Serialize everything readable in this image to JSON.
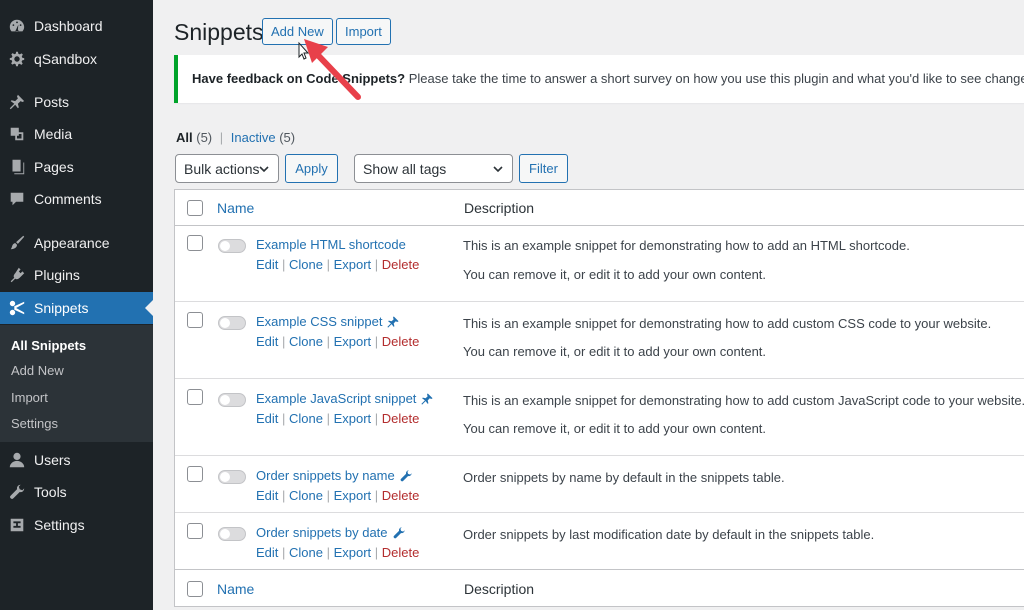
{
  "sidebar": {
    "items": [
      {
        "label": "Dashboard",
        "icon": "dashboard-icon"
      },
      {
        "label": "qSandbox",
        "icon": "gear-icon"
      },
      {
        "label": "Posts",
        "icon": "pin-icon"
      },
      {
        "label": "Media",
        "icon": "media-icon"
      },
      {
        "label": "Pages",
        "icon": "pages-icon"
      },
      {
        "label": "Comments",
        "icon": "comments-icon"
      },
      {
        "label": "Appearance",
        "icon": "brush-icon"
      },
      {
        "label": "Plugins",
        "icon": "plugin-icon"
      },
      {
        "label": "Snippets",
        "icon": "scissors-icon"
      },
      {
        "label": "Users",
        "icon": "user-icon"
      },
      {
        "label": "Tools",
        "icon": "wrench-icon"
      },
      {
        "label": "Settings",
        "icon": "settings-icon"
      }
    ],
    "submenu": [
      "All Snippets",
      "Add New",
      "Import",
      "Settings"
    ]
  },
  "header": {
    "title": "Snippets",
    "add_new": "Add New",
    "import": "Import"
  },
  "notice": {
    "bold": "Have feedback on Code Snippets?",
    "text": " Please take the time to answer a short survey on how you use this plugin and what you'd like to see changed or added"
  },
  "filters": {
    "all_label": "All",
    "all_count": "(5)",
    "separator": "|",
    "inactive_label": "Inactive",
    "inactive_count": "(5)",
    "bulk_actions": "Bulk actions",
    "apply": "Apply",
    "tags": "Show all tags",
    "filter": "Filter"
  },
  "table": {
    "col_name": "Name",
    "col_description": "Description",
    "action_edit": "Edit",
    "action_clone": "Clone",
    "action_export": "Export",
    "action_delete": "Delete",
    "rows": [
      {
        "name": "Example HTML shortcode",
        "icon": "",
        "desc1": "This is an example snippet for demonstrating how to add an HTML shortcode.",
        "desc2": "You can remove it, or edit it to add your own content."
      },
      {
        "name": "Example CSS snippet",
        "icon": "pin-icon",
        "desc1": "This is an example snippet for demonstrating how to add custom CSS code to your website.",
        "desc2": "You can remove it, or edit it to add your own content."
      },
      {
        "name": "Example JavaScript snippet",
        "icon": "pin-icon",
        "desc1": "This is an example snippet for demonstrating how to add custom JavaScript code to your website.",
        "desc2": "You can remove it, or edit it to add your own content."
      },
      {
        "name": "Order snippets by name",
        "icon": "wrench-icon",
        "desc1": "Order snippets by name by default in the snippets table.",
        "desc2": ""
      },
      {
        "name": "Order snippets by date",
        "icon": "wrench-icon",
        "desc1": "Order snippets by last modification date by default in the snippets table.",
        "desc2": ""
      }
    ]
  },
  "colors": {
    "sidebar_bg": "#1d2327",
    "accent": "#2271b1",
    "delete": "#b32d2e",
    "notice_border": "#00a32a",
    "arrow": "#e8404a"
  }
}
